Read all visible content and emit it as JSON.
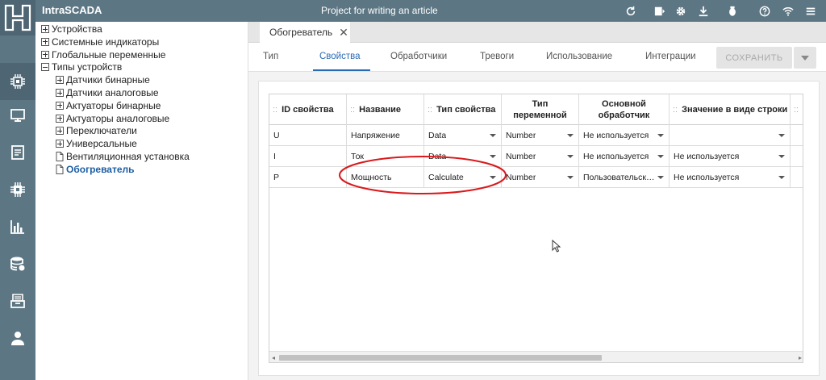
{
  "header": {
    "brand": "IntraSCADA",
    "project_title": "Project for writing an article",
    "icons": [
      "refresh-icon",
      "play-screen-icon",
      "gear-icon",
      "download-icon",
      "bug-icon",
      "help-icon",
      "wifi-icon",
      "menu-icon"
    ]
  },
  "rail": {
    "icons": [
      "chip-icon",
      "monitor-icon",
      "document-icon",
      "processor-icon",
      "bar-chart-icon",
      "database-icon",
      "archive-icon",
      "user-icon"
    ]
  },
  "tree": {
    "items": [
      {
        "label": "Устройства",
        "kind": "plus",
        "level": 0
      },
      {
        "label": "Системные индикаторы",
        "kind": "plus",
        "level": 0
      },
      {
        "label": "Глобальные переменные",
        "kind": "plus",
        "level": 0
      },
      {
        "label": "Типы устройств",
        "kind": "minus",
        "level": 0
      },
      {
        "label": "Датчики бинарные",
        "kind": "plus",
        "level": 1
      },
      {
        "label": "Датчики аналоговые",
        "kind": "plus",
        "level": 1
      },
      {
        "label": "Актуаторы бинарные",
        "kind": "plus",
        "level": 1
      },
      {
        "label": "Актуаторы аналоговые",
        "kind": "plus",
        "level": 1
      },
      {
        "label": "Переключатели",
        "kind": "plus",
        "level": 1
      },
      {
        "label": "Универсальные",
        "kind": "plus",
        "level": 1
      },
      {
        "label": "Вентиляционная установка",
        "kind": "file",
        "level": 1
      },
      {
        "label": "Обогреватель",
        "kind": "file",
        "level": 1,
        "selected": true
      }
    ]
  },
  "doc_tab": {
    "label": "Обогреватель",
    "close": "✕"
  },
  "tabs": [
    {
      "label": "Тип"
    },
    {
      "label": "Свойства",
      "active": true
    },
    {
      "label": "Обработчики"
    },
    {
      "label": "Тревоги"
    },
    {
      "label": "Использование"
    },
    {
      "label": "Интеграции"
    }
  ],
  "save_button": "СОХРАНИТЬ",
  "table": {
    "drag_glyph": "::",
    "columns": [
      "ID свойства",
      "Название",
      "Тип свойства",
      "Тип переменной",
      "Основной обработчик",
      "Значение в виде строки",
      "Т"
    ],
    "column_lines": [
      [
        "ID свойства"
      ],
      [
        "Название"
      ],
      [
        "Тип свойства"
      ],
      [
        "Тип",
        "переменной"
      ],
      [
        "Основной",
        "обработчик"
      ],
      [
        "Значение в виде строки"
      ],
      [
        "Т"
      ]
    ],
    "rows": [
      [
        "U",
        "Напряжение",
        "Data",
        "Number",
        "Не используется",
        ""
      ],
      [
        "I",
        "Ток",
        "Data",
        "Number",
        "Не используется",
        "Не используется"
      ],
      [
        "P",
        "Мощность",
        "Calculate",
        "Number",
        "Пользовательск…",
        "Не используется"
      ]
    ]
  },
  "colors": {
    "header_bg": "#5d7683",
    "accent": "#2a6bb3",
    "annotation": "#d9191c"
  }
}
